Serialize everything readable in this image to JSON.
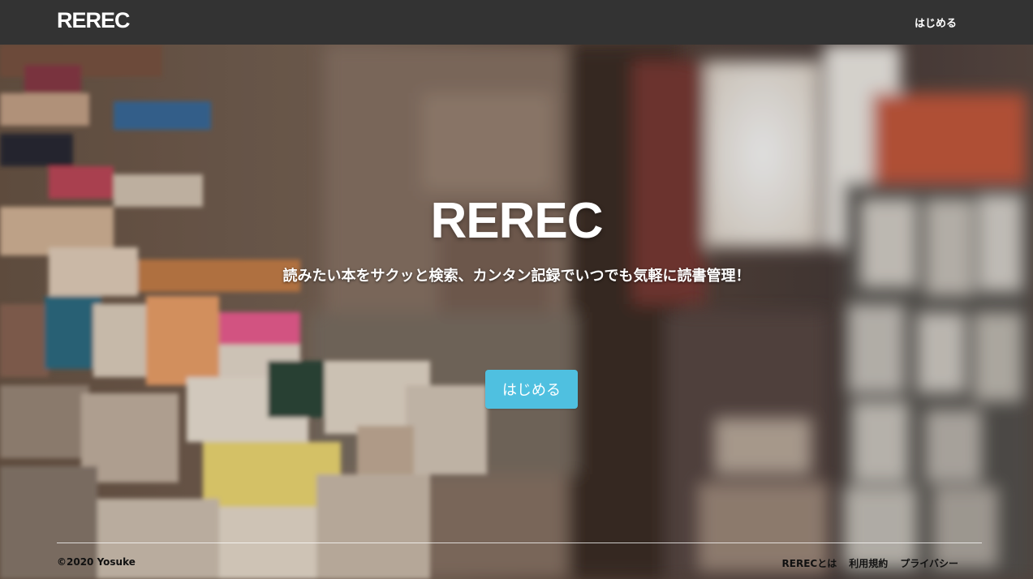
{
  "navbar": {
    "brand": "REREC",
    "start_link": "はじめる"
  },
  "hero": {
    "title": "REREC",
    "subtitle": "読みたい本をサクッと検索、カンタン記録でいつでも気軽に読書管理！",
    "cta_label": "はじめる",
    "background_image": "blurred-bookshelf-photo"
  },
  "footer": {
    "copyright": "©2020 Yosuke",
    "links": [
      "RERECとは",
      "利用規約",
      "プライバシー"
    ]
  },
  "colors": {
    "navbar_bg": "#333333",
    "cta_bg": "#4fc0e0",
    "text_light": "#ffffff",
    "footer_text": "#111111"
  }
}
